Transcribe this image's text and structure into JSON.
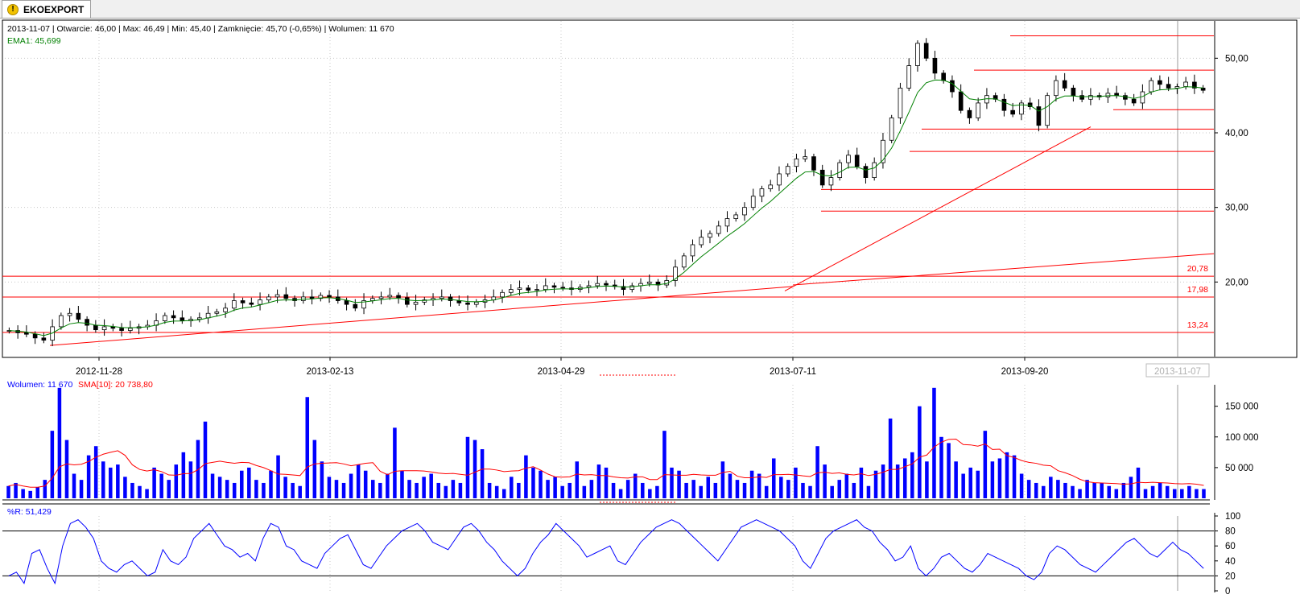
{
  "tab": {
    "title": "EKOEXPORT",
    "icon": "warning-icon"
  },
  "header": {
    "ohlc_text": "2013-11-07 | Otwarcie: 46,00 | Max: 46,49 | Min: 45,40 | Zamknięcie: 45,70 (-0,65%)  | Wolumen: 11 670",
    "ema_text": "EMA1: 45,699"
  },
  "volume_panel": {
    "label_volume": "Wolumen: 11 670",
    "label_sma": "SMA[10]: 20 738,80"
  },
  "wr_panel": {
    "label": "%R: 51,429"
  },
  "colors": {
    "up_candle": "#ffffff",
    "down_candle": "#000000",
    "ema": "#008000",
    "levels": "#ff0000",
    "volume_bars": "#0000ff",
    "sma": "#ff0000",
    "wr": "#0000ff",
    "grid": "#c8c8c8"
  },
  "chart_data": [
    {
      "type": "candlestick",
      "x_dates": [
        "2012-11-28",
        "2013-02-13",
        "2013-04-29",
        "2013-07-11",
        "2013-09-20"
      ],
      "highlighted_date": "2013-11-07",
      "ylim": [
        10,
        55
      ],
      "yticks": [
        "20,00",
        "30,00",
        "40,00",
        "50,00"
      ],
      "grid": true,
      "level_labels": [
        "20,78",
        "17,98",
        "13,24"
      ],
      "horizontal_levels": [
        53.0,
        48.4,
        43.1,
        40.5,
        37.5,
        32.4,
        29.5,
        20.78,
        17.98,
        13.24
      ],
      "close_approx": [
        13.5,
        13.2,
        13.0,
        12.5,
        12.2,
        14.0,
        15.5,
        15.8,
        15.0,
        14.2,
        13.6,
        14.0,
        13.8,
        13.5,
        13.8,
        14.0,
        14.2,
        14.8,
        15.5,
        15.2,
        14.8,
        15.0,
        15.2,
        15.8,
        16.0,
        16.5,
        17.5,
        17.2,
        17.0,
        17.6,
        18.0,
        18.3,
        17.8,
        17.5,
        18.0,
        17.8,
        18.2,
        18.0,
        17.5,
        17.0,
        16.5,
        17.5,
        17.8,
        18.0,
        18.2,
        17.9,
        17.0,
        17.3,
        17.6,
        17.8,
        18.0,
        17.5,
        17.2,
        17.0,
        17.3,
        17.6,
        18.0,
        18.6,
        19.0,
        19.2,
        18.9,
        19.0,
        19.5,
        19.3,
        19.2,
        19.0,
        19.3,
        19.5,
        19.8,
        19.6,
        19.4,
        19.0,
        19.5,
        19.8,
        20.0,
        19.6,
        20.2,
        22.0,
        23.5,
        25.0,
        26.0,
        26.5,
        27.5,
        28.5,
        29.0,
        30.0,
        31.5,
        32.5,
        33.0,
        34.5,
        35.5,
        36.5,
        36.8,
        35.0,
        33.0,
        34.0,
        36.0,
        37.0,
        35.5,
        34.0,
        36.0,
        39.0,
        42.0,
        46.0,
        49.0,
        52.0,
        50.0,
        48.0,
        47.0,
        45.5,
        43.0,
        42.0,
        44.0,
        45.0,
        44.5,
        43.0,
        42.5,
        44.0,
        43.5,
        41.0,
        45.0,
        47.0,
        46.0,
        45.0,
        44.5,
        45.0,
        44.8,
        45.3,
        45.0,
        44.5,
        44.0,
        45.5,
        47.0,
        46.5,
        46.0,
        46.2,
        46.8,
        46.0,
        45.7
      ],
      "ema_label": "EMA1",
      "ema_last": 45.699
    },
    {
      "type": "bar",
      "series": [
        {
          "name": "Wolumen"
        },
        {
          "name": "SMA[10]"
        }
      ],
      "yticks": [
        "50 000",
        "100 000",
        "150 000"
      ],
      "ylim": [
        0,
        185000
      ],
      "values_approx": [
        20000,
        25000,
        15000,
        12000,
        18000,
        30000,
        110000,
        180000,
        95000,
        40000,
        30000,
        70000,
        85000,
        60000,
        50000,
        55000,
        35000,
        25000,
        20000,
        15000,
        50000,
        40000,
        30000,
        55000,
        75000,
        60000,
        95000,
        125000,
        40000,
        35000,
        30000,
        25000,
        45000,
        50000,
        30000,
        25000,
        45000,
        70000,
        35000,
        25000,
        20000,
        165000,
        95000,
        60000,
        35000,
        30000,
        25000,
        40000,
        55000,
        45000,
        30000,
        25000,
        40000,
        115000,
        45000,
        30000,
        25000,
        35000,
        40000,
        25000,
        20000,
        30000,
        25000,
        100000,
        95000,
        80000,
        25000,
        20000,
        15000,
        35000,
        25000,
        70000,
        50000,
        45000,
        30000,
        35000,
        20000,
        25000,
        60000,
        20000,
        30000,
        55000,
        50000,
        25000,
        15000,
        30000,
        40000,
        25000,
        15000,
        20000,
        110000,
        50000,
        45000,
        25000,
        30000,
        20000,
        35000,
        25000,
        60000,
        40000,
        30000,
        25000,
        45000,
        40000,
        20000,
        65000,
        35000,
        30000,
        50000,
        25000,
        20000,
        85000,
        55000,
        20000,
        30000,
        40000,
        25000,
        50000,
        20000,
        45000,
        55000,
        130000,
        55000,
        65000,
        75000,
        150000,
        60000,
        180000,
        100000,
        90000,
        60000,
        40000,
        50000,
        45000,
        110000,
        60000,
        65000,
        75000,
        70000,
        40000,
        30000,
        25000,
        20000,
        35000,
        30000,
        25000,
        20000,
        15000,
        30000,
        25000,
        25000,
        20000,
        15000,
        25000,
        35000,
        50000,
        15000,
        20000,
        25000,
        20000,
        15000,
        15000,
        20000,
        15000,
        15000
      ],
      "sma_last": 20738.8,
      "volume_last": 11670
    },
    {
      "type": "line",
      "series": [
        {
          "name": "%R"
        }
      ],
      "ylim": [
        0,
        100
      ],
      "yticks": [
        "0",
        "20",
        "40",
        "60",
        "80",
        "100"
      ],
      "bands": [
        20,
        80
      ],
      "values_approx": [
        20,
        25,
        10,
        50,
        55,
        30,
        10,
        60,
        90,
        95,
        85,
        70,
        40,
        30,
        25,
        35,
        40,
        30,
        20,
        25,
        55,
        40,
        35,
        45,
        70,
        80,
        90,
        75,
        60,
        55,
        45,
        50,
        40,
        70,
        90,
        85,
        60,
        55,
        40,
        35,
        30,
        50,
        60,
        70,
        75,
        55,
        35,
        30,
        45,
        60,
        70,
        80,
        85,
        90,
        80,
        65,
        60,
        55,
        70,
        85,
        90,
        80,
        65,
        55,
        40,
        30,
        20,
        30,
        50,
        65,
        75,
        90,
        80,
        70,
        60,
        45,
        50,
        55,
        60,
        40,
        35,
        50,
        65,
        75,
        85,
        90,
        95,
        90,
        80,
        70,
        60,
        50,
        40,
        55,
        70,
        85,
        90,
        95,
        90,
        85,
        80,
        70,
        60,
        40,
        30,
        50,
        70,
        80,
        85,
        90,
        95,
        85,
        80,
        65,
        55,
        40,
        45,
        60,
        30,
        20,
        30,
        45,
        50,
        40,
        30,
        25,
        35,
        50,
        45,
        40,
        35,
        30,
        20,
        15,
        25,
        50,
        60,
        55,
        45,
        35,
        30,
        25,
        35,
        45,
        55,
        65,
        70,
        60,
        50,
        45,
        55,
        65,
        55,
        50,
        40,
        30
      ],
      "last_value": 51.429
    }
  ]
}
